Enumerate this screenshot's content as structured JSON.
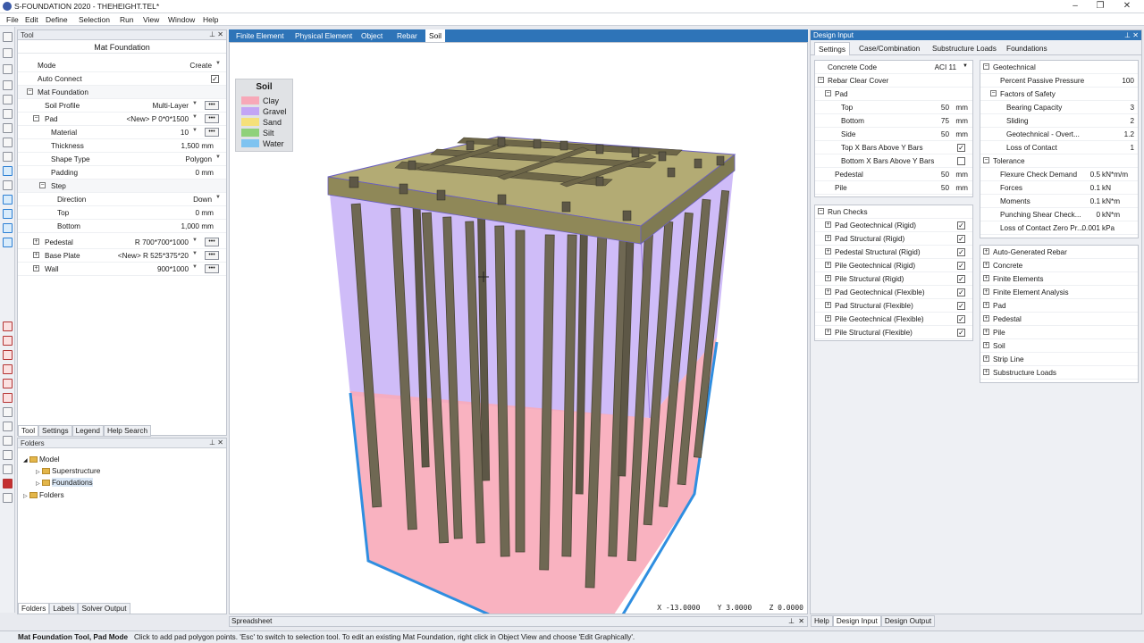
{
  "app": {
    "title": "S-FOUNDATION 2020 - THEHEIGHT.TEL*"
  },
  "menu": [
    "File",
    "Edit",
    "Define",
    "Selection",
    "Run",
    "View",
    "Window",
    "Help"
  ],
  "tool_panel": {
    "header": "Tool",
    "title": "Mat Foundation",
    "rows": [
      {
        "label": "Mode",
        "value": "Create"
      },
      {
        "label": "Auto Connect",
        "value": "✓"
      },
      {
        "label": "Mat Foundation",
        "value": ""
      },
      {
        "label": "Soil Profile",
        "value": "Multi-Layer"
      },
      {
        "label": "Pad",
        "value": "<New> P 0*0*1500"
      },
      {
        "label": "Material",
        "value": "10"
      },
      {
        "label": "Thickness",
        "value": "1,500",
        "unit": "mm"
      },
      {
        "label": "Shape Type",
        "value": "Polygon"
      },
      {
        "label": "Padding",
        "value": "0",
        "unit": "mm"
      },
      {
        "label": "Step",
        "value": ""
      },
      {
        "label": "Direction",
        "value": "Down"
      },
      {
        "label": "Top",
        "value": "0",
        "unit": "mm"
      },
      {
        "label": "Bottom",
        "value": "1,000",
        "unit": "mm"
      },
      {
        "label": "Pedestal",
        "value": "R 700*700*1000"
      },
      {
        "label": "Base Plate",
        "value": "<New> R 525*375*20"
      },
      {
        "label": "Wall",
        "value": "900*1000"
      }
    ],
    "tabs": [
      "Tool",
      "Settings",
      "Legend",
      "Help Search"
    ]
  },
  "folders_panel": {
    "header": "Folders",
    "items": [
      "Model",
      "Superstructure",
      "Foundations",
      "Folders"
    ],
    "tabs": [
      "Folders",
      "Labels",
      "Solver Output"
    ]
  },
  "view_tabs": [
    "Finite Element",
    "Physical Element",
    "Object",
    "Rebar",
    "Soil"
  ],
  "legend": {
    "title": "Soil",
    "items": [
      {
        "name": "Clay",
        "color": "#f7a8b8"
      },
      {
        "name": "Gravel",
        "color": "#c3a5f5"
      },
      {
        "name": "Sand",
        "color": "#f5e07a"
      },
      {
        "name": "Silt",
        "color": "#8fd17a"
      },
      {
        "name": "Water",
        "color": "#7ec3f0"
      }
    ]
  },
  "coords": {
    "x": "X -13.0000",
    "y": "Y    3.0000",
    "z": "Z    0.0000"
  },
  "spreadsheet": "Spreadsheet",
  "design": {
    "header": "Design Input",
    "tabs": [
      "Settings",
      "Case/Combination",
      "Substructure Loads",
      "Foundations"
    ],
    "left_rows": [
      {
        "label": "Concrete Code",
        "value": "ACI 11"
      },
      {
        "label": "Rebar Clear Cover",
        "value": ""
      },
      {
        "label": "Pad",
        "value": ""
      },
      {
        "label": "Top",
        "value": "50",
        "unit": "mm"
      },
      {
        "label": "Bottom",
        "value": "75",
        "unit": "mm"
      },
      {
        "label": "Side",
        "value": "50",
        "unit": "mm"
      },
      {
        "label": "Top X Bars Above Y Bars",
        "value": "✓"
      },
      {
        "label": "Bottom X Bars Above Y Bars",
        "value": ""
      },
      {
        "label": "Pedestal",
        "value": "50",
        "unit": "mm"
      },
      {
        "label": "Pile",
        "value": "50",
        "unit": "mm"
      }
    ],
    "run_checks_title": "Run Checks",
    "run_checks": [
      "Pad Geotechnical (Rigid)",
      "Pad Structural (Rigid)",
      "Pedestal Structural (Rigid)",
      "Pile Geotechnical (Rigid)",
      "Pile Structural (Rigid)",
      "Pad Geotechnical (Flexible)",
      "Pad Structural (Flexible)",
      "Pile Geotechnical (Flexible)",
      "Pile Structural (Flexible)"
    ],
    "right_rows": [
      {
        "label": "Geotechnical",
        "value": ""
      },
      {
        "label": "Percent Passive Pressure",
        "value": "100"
      },
      {
        "label": "Factors of Safety",
        "value": ""
      },
      {
        "label": "Bearing Capacity",
        "value": "3"
      },
      {
        "label": "Sliding",
        "value": "2"
      },
      {
        "label": "Geotechnical - Overt...",
        "value": "1.2"
      },
      {
        "label": "Loss of Contact",
        "value": "1"
      },
      {
        "label": "Tolerance",
        "value": ""
      },
      {
        "label": "Flexure Check Demand",
        "value": "0.5",
        "unit": "kN*m/m"
      },
      {
        "label": "Forces",
        "value": "0.1",
        "unit": "kN"
      },
      {
        "label": "Moments",
        "value": "0.1",
        "unit": "kN*m"
      },
      {
        "label": "Punching Shear Check...",
        "value": "0",
        "unit": "kN*m"
      },
      {
        "label": "Loss of Contact Zero Pr...",
        "value": "0.001",
        "unit": "kPa"
      }
    ],
    "groups": [
      "Auto-Generated Rebar",
      "Concrete",
      "Finite Elements",
      "Finite Element Analysis",
      "Pad",
      "Pedestal",
      "Pile",
      "Soil",
      "Strip Line",
      "Substructure Loads"
    ],
    "bottom_tabs": [
      "Help",
      "Design Input",
      "Design Output"
    ]
  },
  "status": {
    "bold": "Mat Foundation Tool, Pad Mode",
    "text": "Click to add pad polygon points. 'Esc' to switch to selection tool. To edit an existing Mat Foundation, right click in Object View and choose 'Edit Graphically'."
  }
}
